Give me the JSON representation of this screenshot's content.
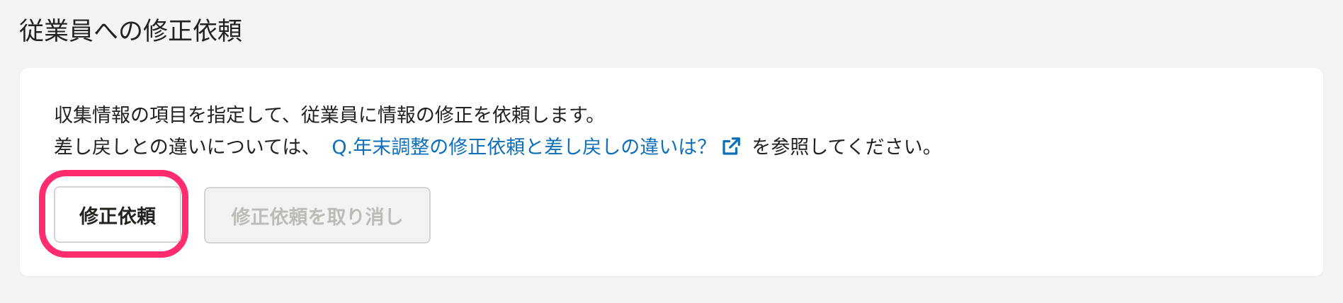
{
  "section": {
    "title": "従業員への修正依頼"
  },
  "description": {
    "line1": "収集情報の項目を指定して、従業員に情報の修正を依頼します。",
    "line2_prefix": "差し戻しとの違いについては、",
    "link_label": "Q.年末調整の修正依頼と差し戻しの違いは？",
    "link_icon": "external-link-icon",
    "line2_suffix": "を参照してください。"
  },
  "buttons": {
    "request_label": "修正依頼",
    "cancel_request_label": "修正依頼を取り消し"
  },
  "colors": {
    "background": "#f5f4f2",
    "card": "#ffffff",
    "link": "#0f6fb8",
    "highlight": "#ff2d6f",
    "disabled_text": "#bdbbb6"
  }
}
